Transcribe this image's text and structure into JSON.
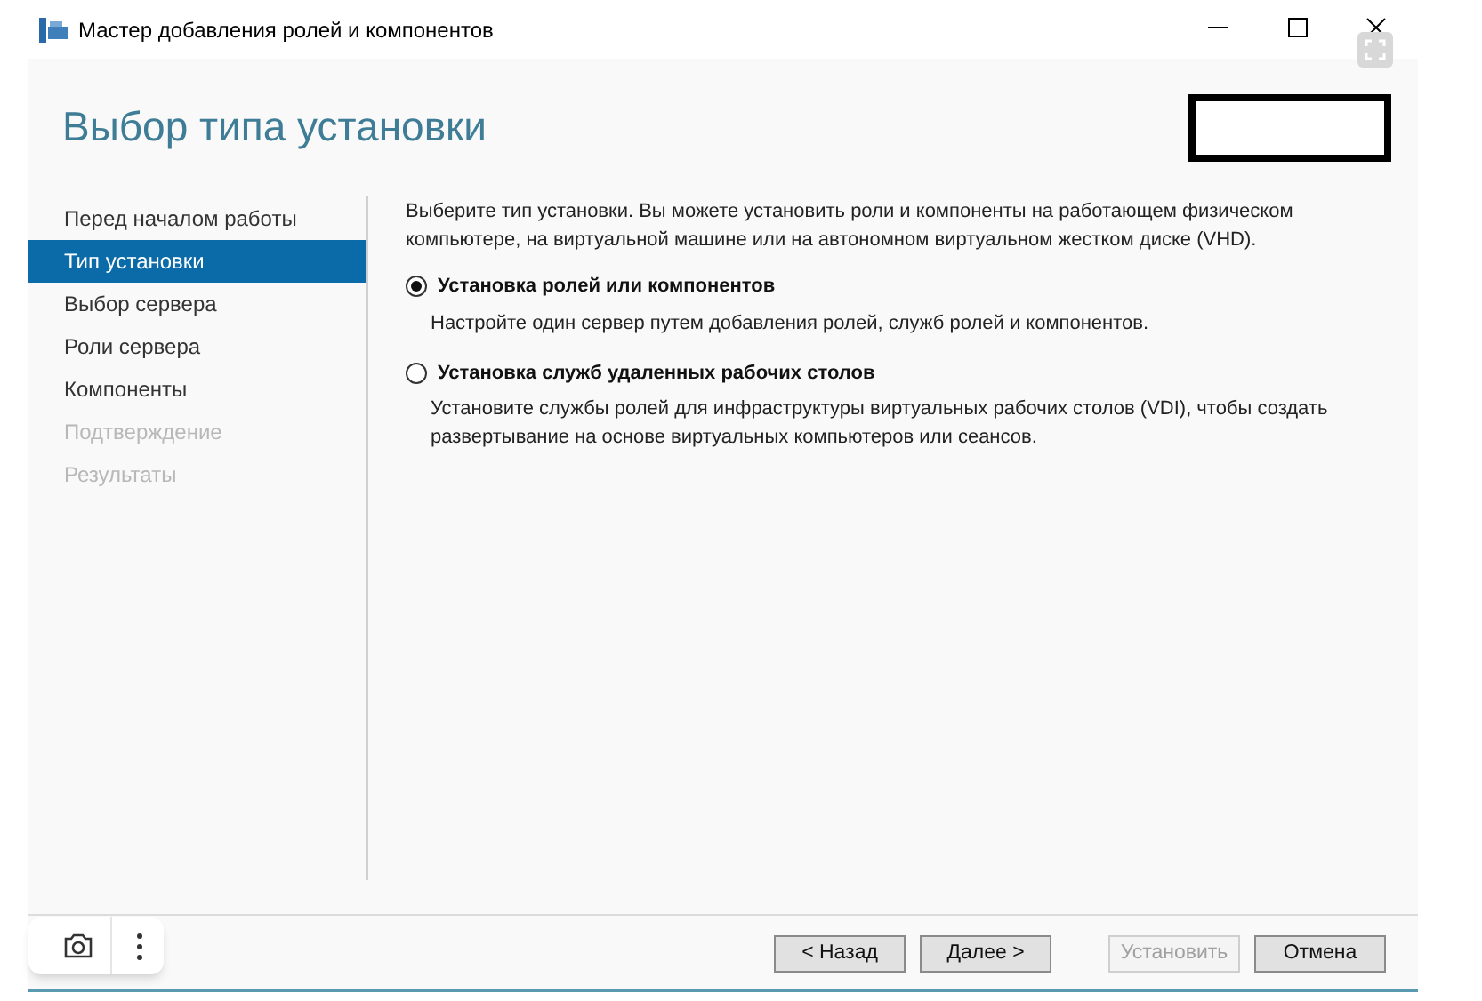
{
  "window": {
    "title": "Мастер добавления ролей и компонентов"
  },
  "page_title": "Выбор типа установки",
  "nav": [
    {
      "label": "Перед началом работы",
      "selected": false,
      "disabled": false
    },
    {
      "label": "Тип установки",
      "selected": true,
      "disabled": false
    },
    {
      "label": "Выбор сервера",
      "selected": false,
      "disabled": false
    },
    {
      "label": "Роли сервера",
      "selected": false,
      "disabled": false
    },
    {
      "label": "Компоненты",
      "selected": false,
      "disabled": false
    },
    {
      "label": "Подтверждение",
      "selected": false,
      "disabled": true
    },
    {
      "label": "Результаты",
      "selected": false,
      "disabled": true
    }
  ],
  "intro": "Выберите тип установки. Вы можете установить роли и компоненты на работающем физическом компьютере, на виртуальной машине или на автономном виртуальном жестком диске (VHD).",
  "options": [
    {
      "label": "Установка ролей или компонентов",
      "description": "Настройте один сервер путем добавления ролей, служб ролей и компонентов.",
      "selected": true
    },
    {
      "label": "Установка служб удаленных рабочих столов",
      "description": "Установите службы ролей для инфраструктуры виртуальных рабочих столов (VDI), чтобы создать развертывание на основе виртуальных компьютеров или сеансов.",
      "selected": false
    }
  ],
  "buttons": [
    {
      "label": "< Назад",
      "disabled": false
    },
    {
      "label": "Далее >",
      "disabled": false
    },
    {
      "label": "Установить",
      "disabled": true
    },
    {
      "label": "Отмена",
      "disabled": false
    }
  ]
}
